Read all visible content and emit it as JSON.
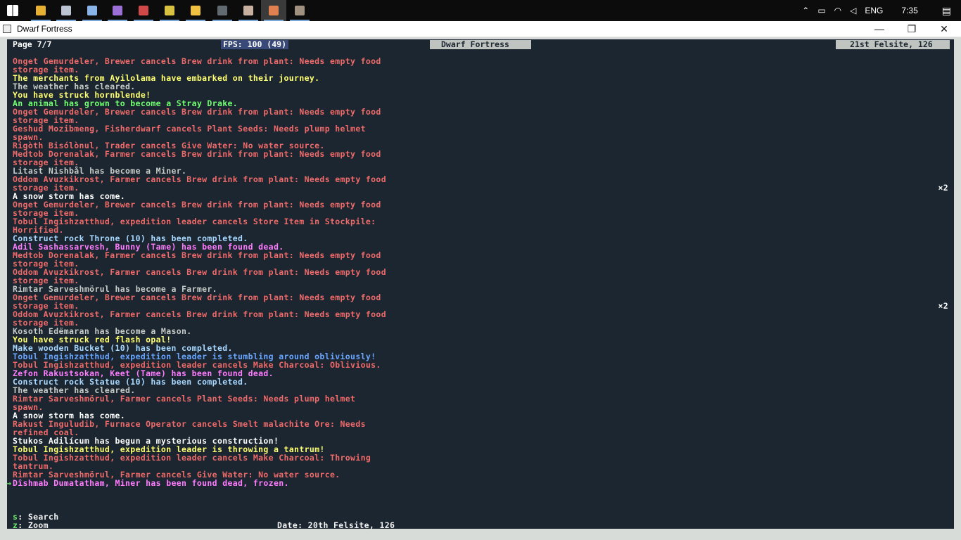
{
  "taskbar": {
    "apps": [
      {
        "icon": "windows-start-icon",
        "color": "#ffffff"
      },
      {
        "icon": "chrome-icon",
        "color": "#e8b030"
      },
      {
        "icon": "calculator-icon",
        "color": "#bcc4d4"
      },
      {
        "icon": "3d-box-icon",
        "color": "#8ab4e8"
      },
      {
        "icon": "visual-studio-icon",
        "color": "#9b6fd6"
      },
      {
        "icon": "media-app-icon",
        "color": "#d04848"
      },
      {
        "icon": "tools-icon",
        "color": "#d8c040"
      },
      {
        "icon": "file-explorer-icon",
        "color": "#f0c040"
      },
      {
        "icon": "terminal-icon",
        "color": "#606a70"
      },
      {
        "icon": "house-app-icon",
        "color": "#c8b0a0"
      },
      {
        "icon": "dwarf-fortress-icon",
        "color": "#e08050"
      },
      {
        "icon": "pickaxe-icon",
        "color": "#a09080"
      }
    ],
    "language": "ENG",
    "time": "7:35"
  },
  "window": {
    "title": "Dwarf Fortress"
  },
  "header": {
    "page": "Page 7/7",
    "fps": "FPS: 100 (49)",
    "game_title": "Dwarf Fortress",
    "date": "21st Felsite, 126"
  },
  "colors": {
    "red": "#f06a6a",
    "yellow": "#ffff70",
    "grey": "#c8ccc8",
    "green": "#70ff70",
    "white": "#ffffff",
    "cyan": "#a8d8ff",
    "magenta": "#ff7cff",
    "blue": "#6aa6ff",
    "console_bg": "#1b2630"
  },
  "log": [
    {
      "text": "Onget Gemurdeler, Brewer cancels Brew drink from plant: Needs empty food",
      "color": "red"
    },
    {
      "text": "storage item.",
      "color": "red"
    },
    {
      "text": "The merchants from Ayilolama have embarked on their journey.",
      "color": "yellow"
    },
    {
      "text": "The weather has cleared.",
      "color": "grey"
    },
    {
      "text": "You have struck hornblende!",
      "color": "yellow"
    },
    {
      "text": "An animal has grown to become a Stray Drake.",
      "color": "green"
    },
    {
      "text": "Onget Gemurdeler, Brewer cancels Brew drink from plant: Needs empty food",
      "color": "red"
    },
    {
      "text": "storage item.",
      "color": "red"
    },
    {
      "text": "Geshud Mozibmeng, Fisherdwarf cancels Plant Seeds: Needs plump helmet",
      "color": "red"
    },
    {
      "text": "spawn.",
      "color": "red"
    },
    {
      "text": "Rigòth Bisólònul, Trader cancels Give Water: No water source.",
      "color": "red"
    },
    {
      "text": "Medtob Dorenalak, Farmer cancels Brew drink from plant: Needs empty food",
      "color": "red"
    },
    {
      "text": "storage item.",
      "color": "red"
    },
    {
      "text": "Litast Nishbål has become a Miner.",
      "color": "grey"
    },
    {
      "text": "Oddom Avuzkikrost, Farmer cancels Brew drink from plant: Needs empty food",
      "color": "red"
    },
    {
      "text": "storage item.",
      "color": "red",
      "repeat": "×2"
    },
    {
      "text": "A snow storm has come.",
      "color": "white"
    },
    {
      "text": "Onget Gemurdeler, Brewer cancels Brew drink from plant: Needs empty food",
      "color": "red"
    },
    {
      "text": "storage item.",
      "color": "red"
    },
    {
      "text": "Tobul Ingishzatthud, expedition leader cancels Store Item in Stockpile:",
      "color": "red"
    },
    {
      "text": "Horrified.",
      "color": "red"
    },
    {
      "text": "Construct rock Throne (10) has been completed.",
      "color": "cyan"
    },
    {
      "text": "Adil Sashassarvesh, Bunny (Tame) has been found dead.",
      "color": "magenta"
    },
    {
      "text": "Medtob Dorenalak, Farmer cancels Brew drink from plant: Needs empty food",
      "color": "red"
    },
    {
      "text": "storage item.",
      "color": "red"
    },
    {
      "text": "Oddom Avuzkikrost, Farmer cancels Brew drink from plant: Needs empty food",
      "color": "red"
    },
    {
      "text": "storage item.",
      "color": "red"
    },
    {
      "text": "Rimtar Sarveshmörul has become a Farmer.",
      "color": "grey"
    },
    {
      "text": "Onget Gemurdeler, Brewer cancels Brew drink from plant: Needs empty food",
      "color": "red"
    },
    {
      "text": "storage item.",
      "color": "red",
      "repeat": "×2"
    },
    {
      "text": "Oddom Avuzkikrost, Farmer cancels Brew drink from plant: Needs empty food",
      "color": "red"
    },
    {
      "text": "storage item.",
      "color": "red"
    },
    {
      "text": "Kosoth Edëmaran has become a Mason.",
      "color": "grey"
    },
    {
      "text": "You have struck red flash opal!",
      "color": "yellow"
    },
    {
      "text": "Make wooden Bucket (10) has been completed.",
      "color": "cyan"
    },
    {
      "text": "Tobul Ingishzatthud, expedition leader is stumbling around obliviously!",
      "color": "blue"
    },
    {
      "text": "Tobul Ingishzatthud, expedition leader cancels Make Charcoal: Oblivious.",
      "color": "red"
    },
    {
      "text": "Zefon Rakustsokan, Keet (Tame) has been found dead.",
      "color": "magenta"
    },
    {
      "text": "Construct rock Statue (10) has been completed.",
      "color": "cyan"
    },
    {
      "text": "The weather has cleared.",
      "color": "grey"
    },
    {
      "text": "Rimtar Sarveshmörul, Farmer cancels Plant Seeds: Needs plump helmet",
      "color": "red"
    },
    {
      "text": "spawn.",
      "color": "red"
    },
    {
      "text": "A snow storm has come.",
      "color": "white"
    },
    {
      "text": "Rakust Inguludib, Furnace Operator cancels Smelt malachite Ore: Needs",
      "color": "red"
    },
    {
      "text": "refined coal.",
      "color": "red"
    },
    {
      "text": "Stukos Adilícum has begun a mysterious construction!",
      "color": "white"
    },
    {
      "text": "Tobul Ingishzatthud, expedition leader is throwing a tantrum!",
      "color": "yellow"
    },
    {
      "text": "Tobul Ingishzatthud, expedition leader cancels Make Charcoal: Throwing",
      "color": "red"
    },
    {
      "text": "tantrum.",
      "color": "red"
    },
    {
      "text": "Rimtar Sarveshmörul, Farmer cancels Give Water: No water source.",
      "color": "red"
    },
    {
      "text": "Dîshmab Dumatatham, Miner has been found dead, frozen.",
      "color": "magenta",
      "selected": true
    }
  ],
  "footer": {
    "search_key": "s",
    "search_label": ": Search",
    "zoom_key": "z",
    "zoom_label": ": Zoom",
    "date": "Date: 20th Felsite, 126"
  }
}
